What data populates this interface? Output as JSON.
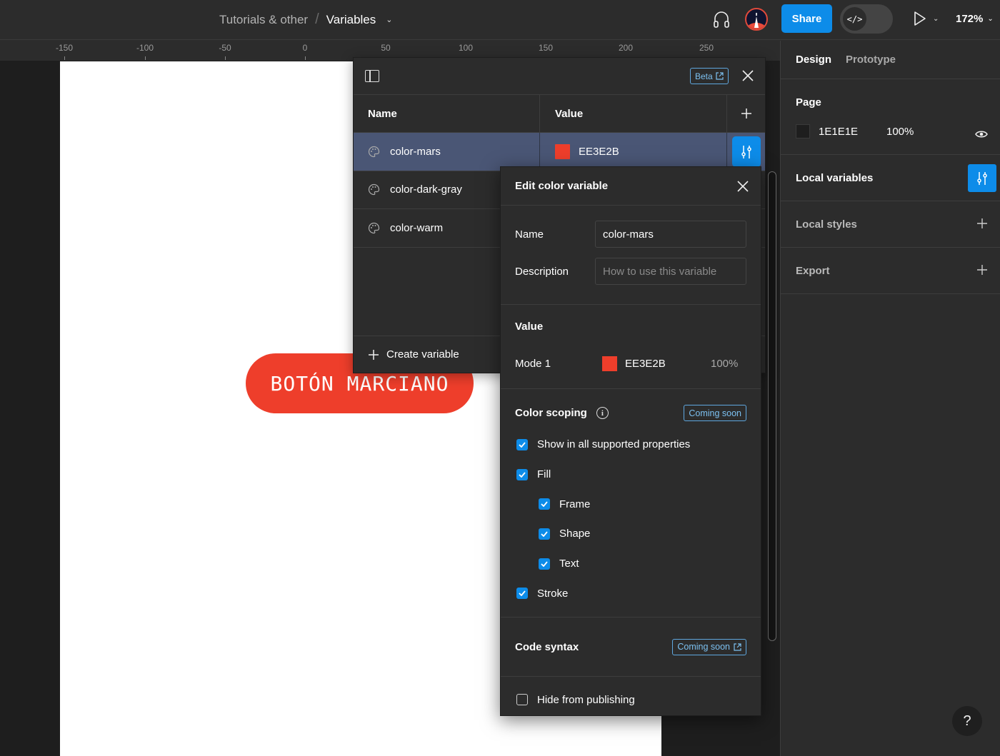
{
  "topbar": {
    "project": "Tutorials & other",
    "separator": "/",
    "file_name": "Variables",
    "share_label": "Share",
    "dev_mode_icon": "</>",
    "zoom": "172%"
  },
  "ruler": {
    "ticks": [
      "-150",
      "-100",
      "-50",
      "0",
      "50",
      "100",
      "150",
      "200",
      "250"
    ]
  },
  "canvas": {
    "button_text": "BOTÓN MARCIANO",
    "button_color": "#EE3E2B"
  },
  "variables_panel": {
    "beta_label": "Beta",
    "columns": {
      "name": "Name",
      "value": "Value"
    },
    "rows": [
      {
        "name": "color-mars",
        "value": "EE3E2B",
        "color": "#EE3E2B",
        "selected": true
      },
      {
        "name": "color-dark-gray"
      },
      {
        "name": "color-warm"
      }
    ],
    "create_label": "Create variable"
  },
  "edit_popup": {
    "title": "Edit color variable",
    "name_label": "Name",
    "name_value": "color-mars",
    "description_label": "Description",
    "description_placeholder": "How to use this variable",
    "value_title": "Value",
    "mode_label": "Mode 1",
    "mode_hex": "EE3E2B",
    "mode_opacity": "100%",
    "scoping_title": "Color scoping",
    "coming_soon": "Coming soon",
    "scopes": [
      {
        "label": "Show in all supported properties",
        "checked": true
      },
      {
        "label": "Fill",
        "checked": true
      },
      {
        "label": "Frame",
        "checked": true
      },
      {
        "label": "Shape",
        "checked": true
      },
      {
        "label": "Text",
        "checked": true
      },
      {
        "label": "Stroke",
        "checked": true
      }
    ],
    "code_syntax_title": "Code syntax",
    "code_syntax_badge": "Coming soon",
    "hide_label": "Hide from publishing",
    "hide_checked": false
  },
  "right_panel": {
    "tabs": [
      "Design",
      "Prototype"
    ],
    "page_title": "Page",
    "page_color": "1E1E1E",
    "page_opacity": "100%",
    "local_variables": "Local variables",
    "local_styles": "Local styles",
    "export": "Export"
  },
  "help_label": "?"
}
